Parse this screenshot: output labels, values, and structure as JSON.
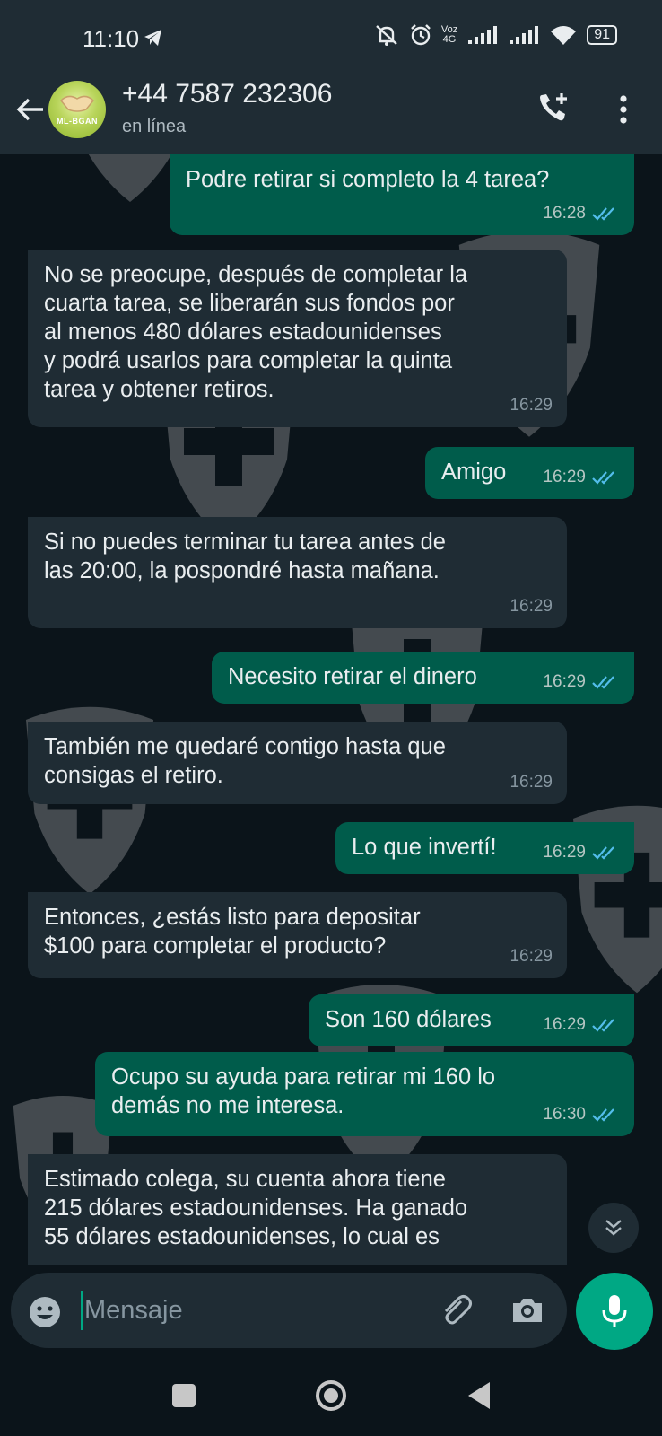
{
  "status_bar": {
    "time": "11:10",
    "network_label": "Voz\n4G",
    "battery": "91"
  },
  "header": {
    "contact_name": "+44 7587 232306",
    "contact_status": "en línea",
    "avatar_text": "ML-BGAN"
  },
  "messages": [
    {
      "direction": "out",
      "text": "Podre retirar si completo la 4 tarea?",
      "time": "16:28",
      "read": true
    },
    {
      "direction": "in",
      "text": "No se preocupe, después de completar la\ncuarta tarea, se liberarán sus fondos por\nal menos 480 dólares estadounidenses\ny podrá usarlos para completar la quinta\ntarea y obtener retiros.",
      "time": "16:29"
    },
    {
      "direction": "out",
      "text": "Amigo",
      "time": "16:29",
      "read": true
    },
    {
      "direction": "in",
      "text": "Si no puedes terminar tu tarea antes de\nlas 20:00, la pospondré hasta mañana.",
      "time": "16:29"
    },
    {
      "direction": "out",
      "text": "Necesito retirar el dinero",
      "time": "16:29",
      "read": true
    },
    {
      "direction": "in",
      "text": "También me quedaré contigo hasta que\nconsigas el retiro.",
      "time": "16:29"
    },
    {
      "direction": "out",
      "text": "Lo que invertí!",
      "time": "16:29",
      "read": true
    },
    {
      "direction": "in",
      "text": "Entonces, ¿estás listo para depositar\n$100 para completar el producto?",
      "time": "16:29"
    },
    {
      "direction": "out",
      "text": "Son 160 dólares",
      "time": "16:29",
      "read": true
    },
    {
      "direction": "out",
      "text": "Ocupo su ayuda para retirar mi 160 lo\ndemás no me interesa.",
      "time": "16:30",
      "read": true
    },
    {
      "direction": "in",
      "text": "Estimado colega, su cuenta ahora tiene\n215 dólares estadounidenses. Ha ganado\n55 dólares estadounidenses, lo cual es",
      "time": ""
    }
  ],
  "input": {
    "placeholder": "Mensaje"
  },
  "colors": {
    "chat_background": "#0b141a",
    "incoming_bubble": "#1f2c34",
    "outgoing_bubble": "#005c4b",
    "accent": "#00a884",
    "read_ticks": "#53bdeb"
  },
  "icons": [
    "back-arrow-icon",
    "add-call-icon",
    "more-vert-icon",
    "scroll-down-icon",
    "emoji-icon",
    "attach-icon",
    "camera-icon",
    "mic-icon",
    "nav-recents-icon",
    "nav-home-icon",
    "nav-back-icon"
  ]
}
